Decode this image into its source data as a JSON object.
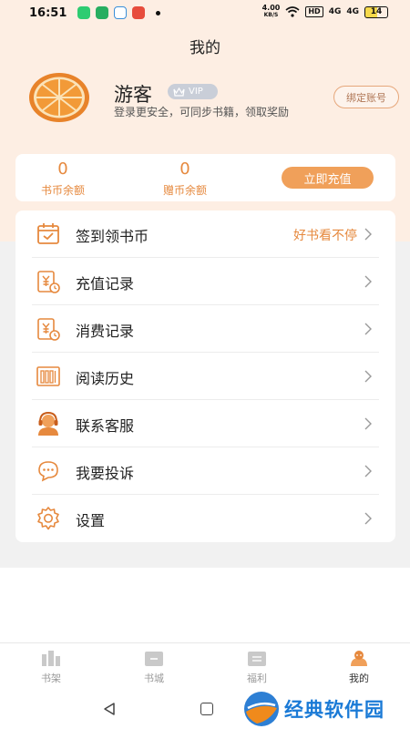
{
  "status_bar": {
    "time": "16:51",
    "net_speed_value": "4.00",
    "net_speed_unit": "KB/S",
    "hd_label": "HD",
    "signal1": "4G",
    "signal2": "4G",
    "battery": "14"
  },
  "page": {
    "title": "我的"
  },
  "profile": {
    "username": "游客",
    "vip_label": "VIP",
    "subtitle": "登录更安全，可同步书籍，领取奖励",
    "bind_button": "绑定账号"
  },
  "balance": {
    "coin_value": "0",
    "coin_label": "书币余额",
    "gift_value": "0",
    "gift_label": "赠币余额",
    "recharge_button": "立即充值"
  },
  "menu": {
    "items": [
      {
        "label": "签到领书币",
        "icon": "calendar-icon",
        "extra": "好书看不停"
      },
      {
        "label": "充值记录",
        "icon": "recharge-record-icon",
        "extra": ""
      },
      {
        "label": "消费记录",
        "icon": "consume-record-icon",
        "extra": ""
      },
      {
        "label": "阅读历史",
        "icon": "bookshelf-icon",
        "extra": ""
      },
      {
        "label": "联系客服",
        "icon": "headset-icon",
        "extra": ""
      },
      {
        "label": "我要投诉",
        "icon": "chat-bubble-icon",
        "extra": ""
      },
      {
        "label": "设置",
        "icon": "gear-icon",
        "extra": ""
      }
    ]
  },
  "bottom_nav": {
    "items": [
      {
        "label": "书架",
        "icon": "bookshelf-nav-icon"
      },
      {
        "label": "书城",
        "icon": "bookstore-nav-icon"
      },
      {
        "label": "福利",
        "icon": "welfare-nav-icon"
      },
      {
        "label": "我的",
        "icon": "profile-nav-icon"
      }
    ],
    "active": "我的"
  },
  "watermark": {
    "text": "经典软件园"
  },
  "colors": {
    "accent": "#f0a05a",
    "accent_text": "#e6893e",
    "header_bg": "#fdeee3",
    "page_bg": "#f1f1f1"
  }
}
